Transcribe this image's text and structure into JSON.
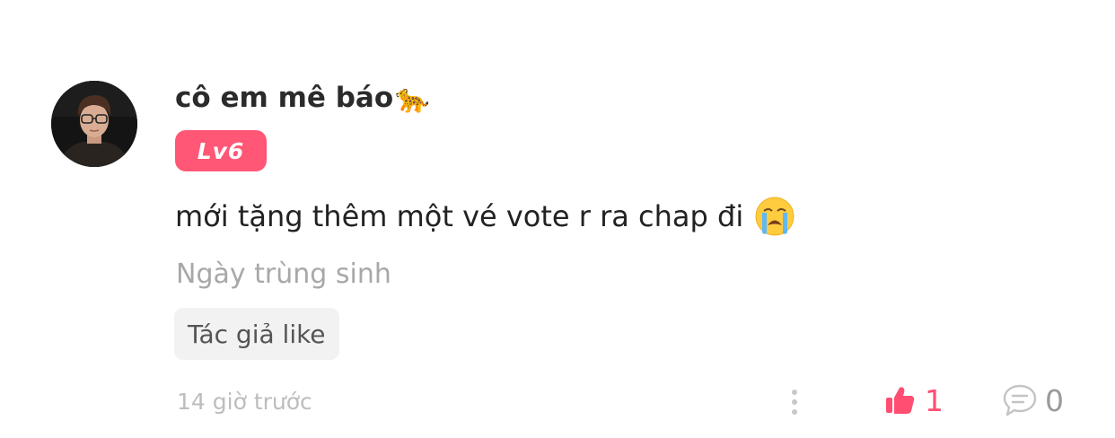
{
  "comment": {
    "username": "cô em mê báo",
    "username_emoji": "🐆",
    "level_badge": "Lv6",
    "text": "mới tặng thêm một vé vote r ra chap đi",
    "text_emoji": "crying-face-emoji",
    "chapter_ref": "Ngày trùng sinh",
    "author_like_label": "Tác giả like",
    "timestamp": "14 giờ trước",
    "likes": "1",
    "replies": "0"
  },
  "colors": {
    "badge": "#ff5775",
    "like_accent": "#ff4e72",
    "muted_text": "#a8a8a8"
  },
  "icons": {
    "avatar": "user-avatar-photo",
    "more": "vertical-dots-icon",
    "like": "thumbs-up-icon",
    "reply": "speech-bubble-icon"
  }
}
